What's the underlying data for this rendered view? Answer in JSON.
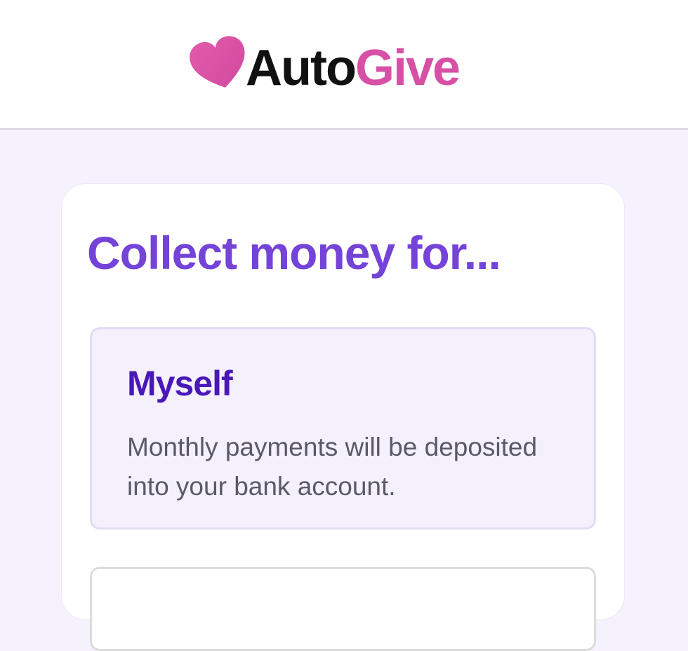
{
  "brand": {
    "name_part1": "Auto",
    "name_part2": "Give",
    "icon": "heart-icon",
    "colors": {
      "dark": "#111111",
      "pink": "#d850a6"
    }
  },
  "main": {
    "title": "Collect money for...",
    "title_color": "#7443d8",
    "options": [
      {
        "title": "Myself",
        "description": "Monthly payments will be deposited into your bank account.",
        "selected": true
      }
    ]
  }
}
